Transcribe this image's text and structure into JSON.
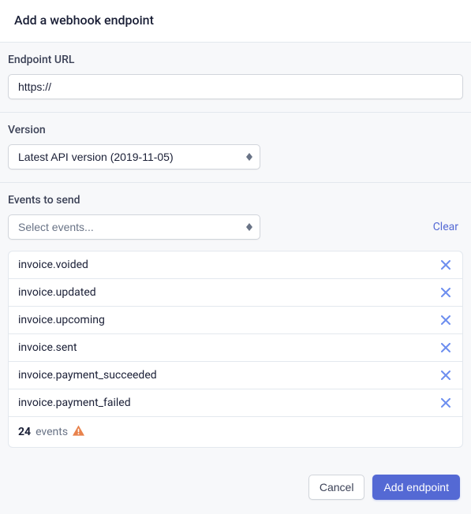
{
  "title": "Add a webhook endpoint",
  "endpoint": {
    "label": "Endpoint URL",
    "value": "https://"
  },
  "version": {
    "label": "Version",
    "selected": "Latest API version (2019-11-05)"
  },
  "events": {
    "label": "Events to send",
    "placeholder": "Select events...",
    "clear": "Clear",
    "items": [
      "invoice.voided",
      "invoice.updated",
      "invoice.upcoming",
      "invoice.sent",
      "invoice.payment_succeeded",
      "invoice.payment_failed"
    ],
    "summary_count": "24",
    "summary_label": "events"
  },
  "footer": {
    "cancel": "Cancel",
    "submit": "Add endpoint"
  }
}
